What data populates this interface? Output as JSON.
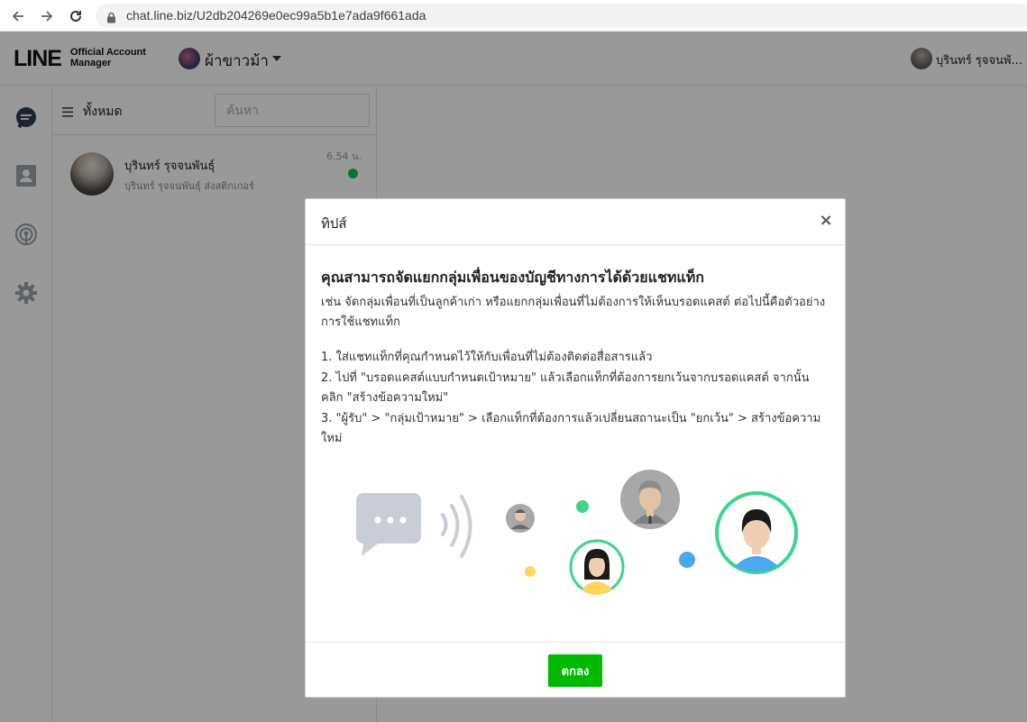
{
  "browser": {
    "url": "chat.line.biz/U2db204269e0ec99a5b1e7ada9f661ada",
    "icons": [
      "back-icon",
      "forward-icon",
      "reload-icon",
      "lock-icon"
    ]
  },
  "header": {
    "logo_main": "LINE",
    "logo_sub_line1": "Official Account",
    "logo_sub_line2": "Manager",
    "account_name": "ผ้าขาวม้า",
    "user_name": "บุรินทร์ รุจจนพั..."
  },
  "sidebar": {
    "icons": [
      "chat-icon",
      "contacts-icon",
      "broadcast-icon",
      "settings-icon"
    ]
  },
  "chat_list": {
    "filter_label": "ทั้งหมด",
    "search_placeholder": "ค้นหา",
    "items": [
      {
        "name": "บุรินทร์ รุจจนพันธุ์",
        "preview": "บุรินทร์ รุจจนพันธุ์ ส่งสติกเกอร์",
        "time": "6.54 น.",
        "status_color": "#06c755"
      }
    ]
  },
  "modal": {
    "title": "ทิปส์",
    "close_label": "×",
    "heading": "คุณสามารถจัดแยกกลุ่มเพื่อนของบัญชีทางการได้ด้วยแชทแท็ก",
    "intro": "เช่น จัดกลุ่มเพื่อนที่เป็นลูกค้าเก่า หรือแยกกลุ่มเพื่อนที่ไม่ต้องการให้เห็นบรอดแคสต์ ต่อไปนี้คือตัวอย่างการใช้แชทแท็ก",
    "steps": [
      "1. ใส่แชทแท็กที่คุณกำหนดไว้ให้กับเพื่อนที่ไม่ต้องติดต่อสื่อสารแล้ว",
      "2. ไปที่ \"บรอดแคสต์แบบกำหนดเป้าหมาย\" แล้วเลือกแท็กที่ต้องการยกเว้นจากบรอดแคสต์ จากนั้นคลิก \"สร้างข้อความใหม่\"",
      "3. \"ผู้รับ\" > \"กลุ่มเป้าหมาย\" > เลือกแท็กที่ต้องการแล้วเปลี่ยนสถานะเป็น \"ยกเว้น\" > สร้างข้อความใหม่"
    ],
    "ok_label": "ตกลง",
    "accent_color": "#00b900"
  }
}
